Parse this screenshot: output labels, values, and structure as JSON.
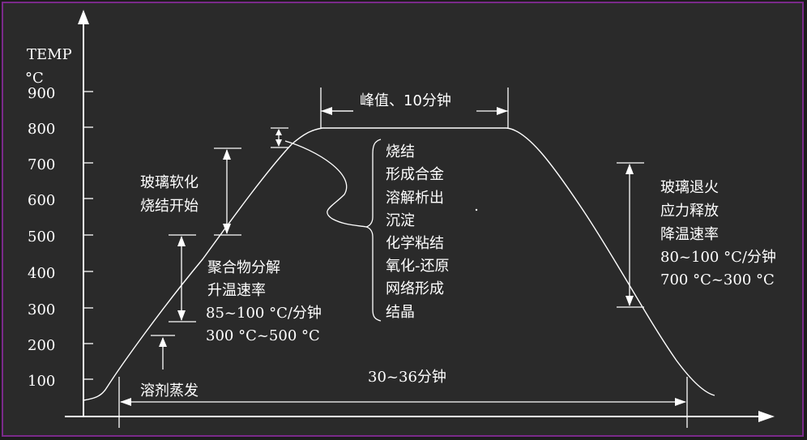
{
  "axes": {
    "y_label_line1": "TEMP",
    "y_label_line2": "°C",
    "y_ticks": [
      "900",
      "800",
      "700",
      "600",
      "500",
      "400",
      "300",
      "200",
      "100"
    ]
  },
  "annotations": {
    "peak": "峰值、10分钟",
    "glass_soften_1": "玻璃软化",
    "glass_soften_2": "烧结开始",
    "polymer_1": "聚合物分解",
    "polymer_2": "升温速率",
    "polymer_3": "85~100 °C/分钟",
    "polymer_4": "300 °C~500 °C",
    "flux": "溶剂蒸发",
    "duration": "30~36分钟",
    "sinter_list": [
      "烧结",
      "形成合金",
      "溶解析出",
      "沉淀",
      "化学粘结",
      "氧化-还原",
      "网络形成",
      "结晶"
    ],
    "anneal_1": "玻璃退火",
    "anneal_2": "应力释放",
    "anneal_3": "降温速率",
    "anneal_4": "80~100 °C/分钟",
    "anneal_5": "700 °C~300 °C"
  }
}
